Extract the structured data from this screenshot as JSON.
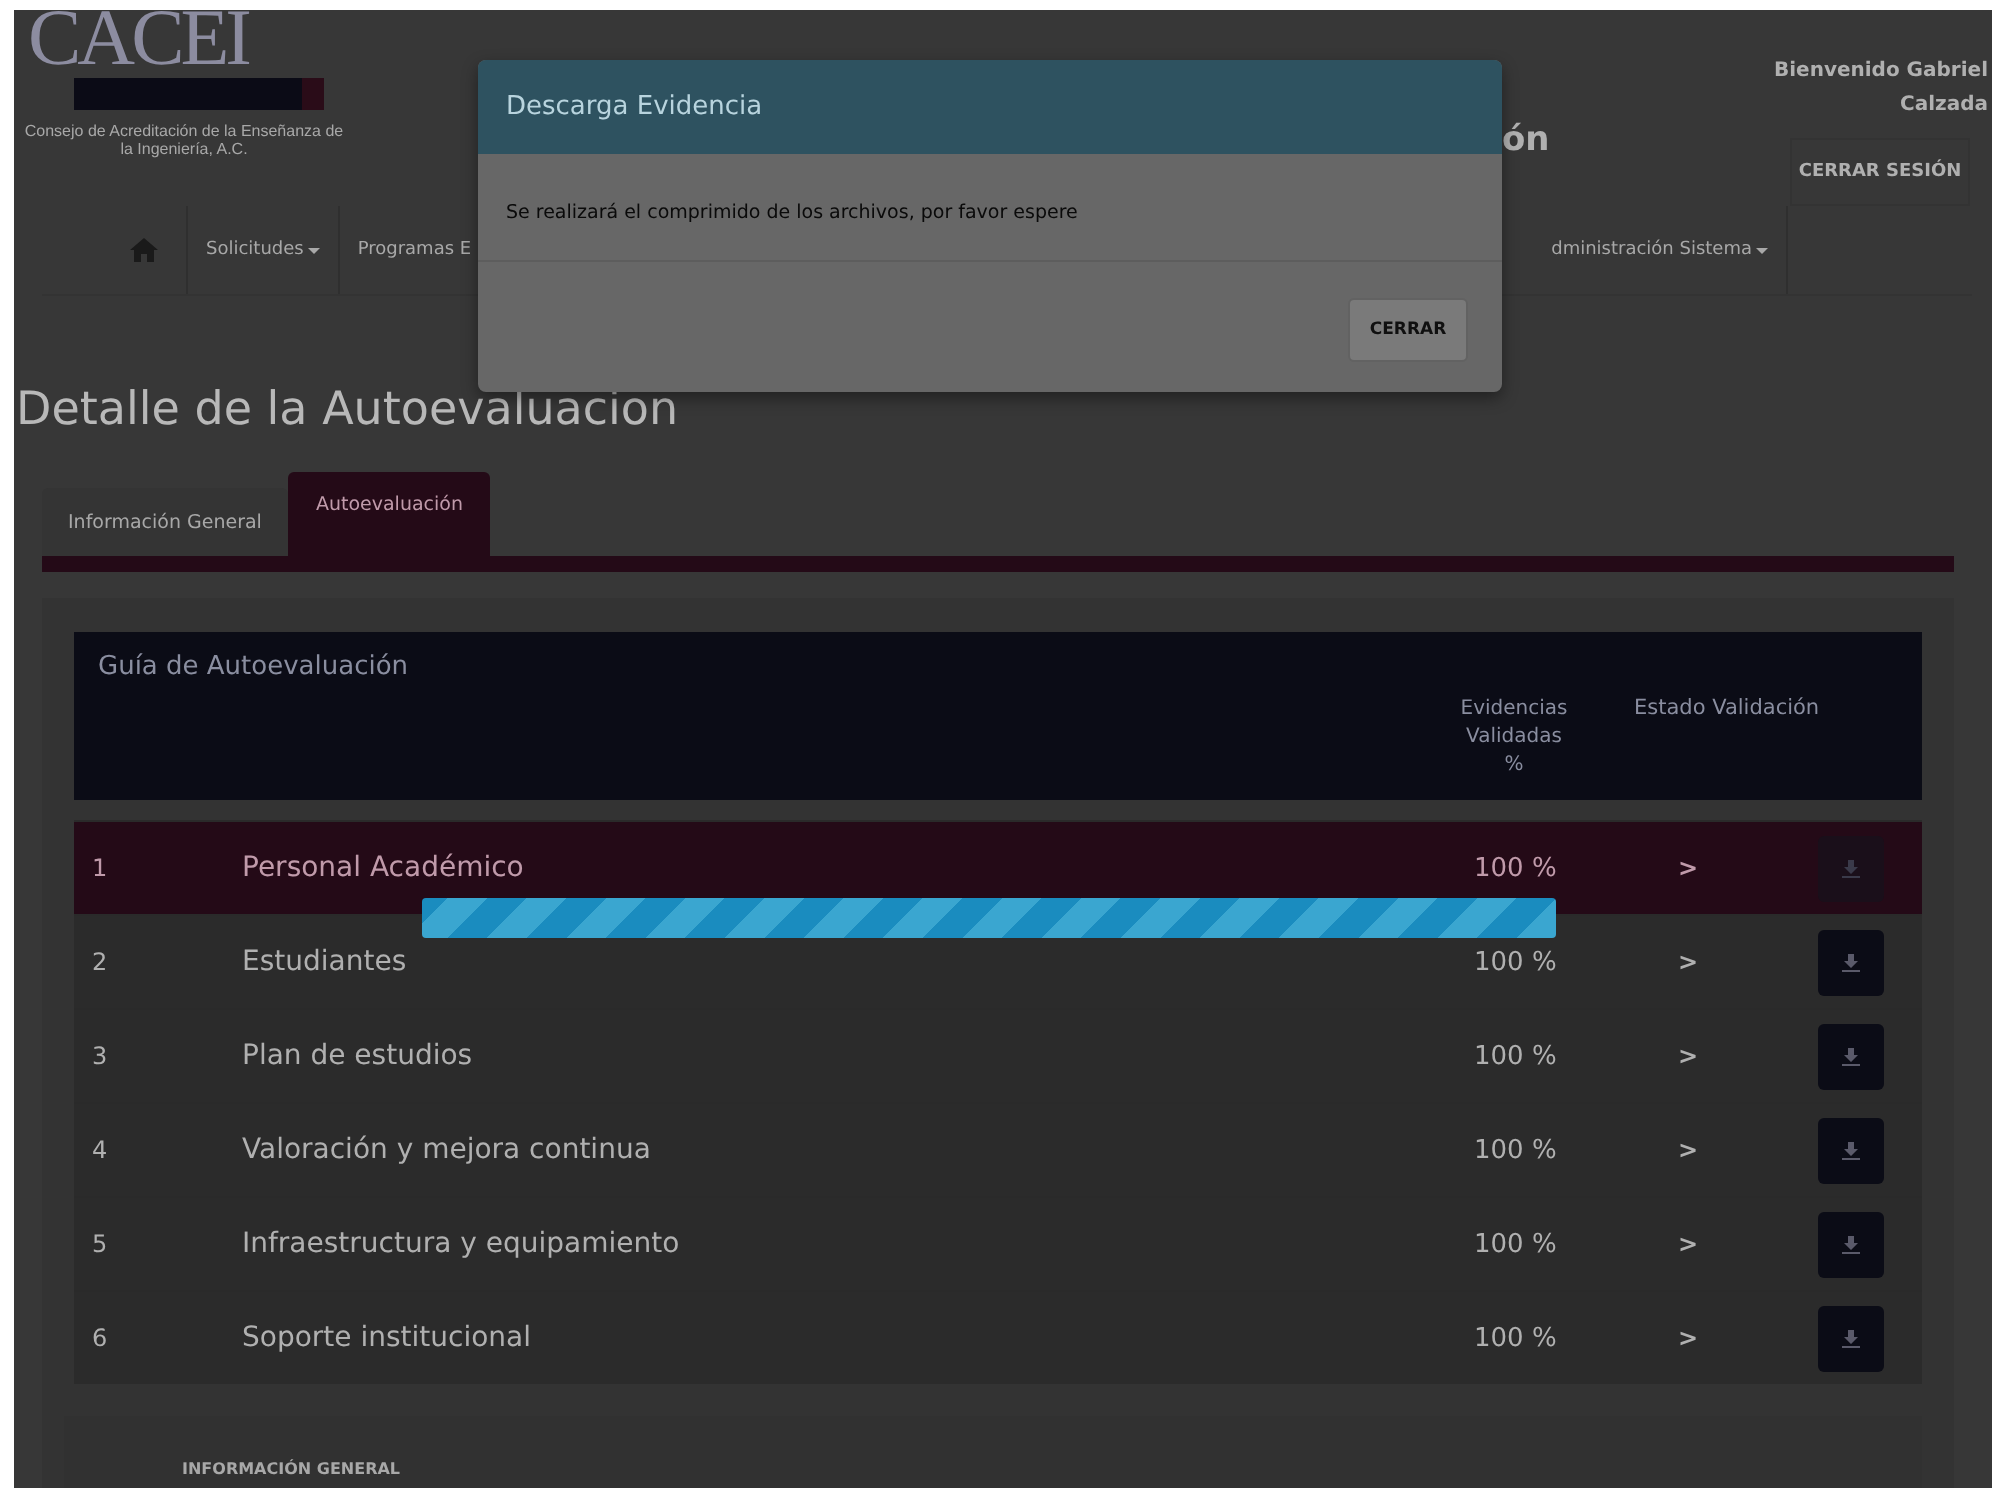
{
  "header": {
    "logo_text": "CACEI",
    "logo_caption": "Consejo de Acreditación de la Enseñanza de la Ingeniería, A.C.",
    "page_title_fragment": "ón",
    "welcome": "Bienvenido Gabriel Calzada",
    "logout_button": "CERRAR SESIÓN"
  },
  "nav": {
    "items": [
      {
        "label": "Solicitudes",
        "dropdown": true
      },
      {
        "label": "Programas E",
        "dropdown": false
      },
      {
        "label": "dministración Sistema",
        "dropdown": true
      }
    ]
  },
  "title": "Detalle de la Autoevaluacion",
  "tabs": [
    {
      "label": "Información General",
      "selected": false
    },
    {
      "label": "Autoevaluación",
      "selected": true
    }
  ],
  "table": {
    "columns": [
      "Guía de Autoevaluación",
      "Evidencias Validadas %",
      "Estado Validación"
    ],
    "rows": [
      {
        "number": "1",
        "name": "Personal Académico",
        "percent": "100 %",
        "chevron": ">",
        "selected": true
      },
      {
        "number": "2",
        "name": "Estudiantes",
        "percent": "100 %",
        "chevron": ">",
        "selected": false
      },
      {
        "number": "3",
        "name": "Plan de estudios",
        "percent": "100 %",
        "chevron": ">",
        "selected": false
      },
      {
        "number": "4",
        "name": "Valoración y mejora continua",
        "percent": "100 %",
        "chevron": ">",
        "selected": false
      },
      {
        "number": "5",
        "name": "Infraestructura y equipamiento",
        "percent": "100 %",
        "chevron": ">",
        "selected": false
      },
      {
        "number": "6",
        "name": "Soporte institucional",
        "percent": "100 %",
        "chevron": ">",
        "selected": false
      }
    ]
  },
  "section_heading": "INFORMACIÓN GENERAL",
  "modal": {
    "title": "Descarga Evidencia",
    "message": "Se realizará el comprimido de los archivos, por favor espere",
    "close_button": "CERRAR"
  },
  "progress": {
    "level": 1
  }
}
